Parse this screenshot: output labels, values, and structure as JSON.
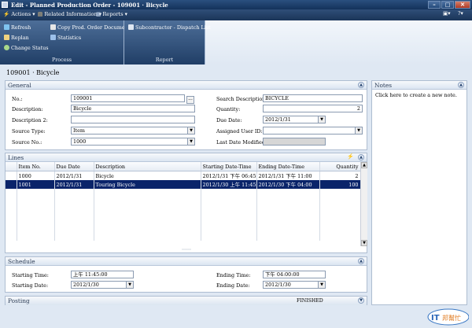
{
  "window": {
    "title": "Edit - Planned Production Order - 109001 · Bicycle",
    "controls": [
      "–",
      "□",
      "✕"
    ]
  },
  "menubar": {
    "items": [
      "Actions ▾",
      "Related Information ▾",
      "Reports ▾"
    ],
    "right_icons": [
      "view-icon",
      "help-icon"
    ]
  },
  "ribbon": {
    "process": {
      "label": "Process",
      "buttons": [
        "Refresh",
        "Replan",
        "Change Status",
        "Copy Prod. Order Document",
        "Statistics"
      ]
    },
    "report": {
      "label": "Report",
      "buttons": [
        "Subcontractor - Dispatch List"
      ]
    }
  },
  "page_heading": "109001 · Bicycle",
  "general": {
    "title": "General",
    "fields": {
      "no_label": "No.:",
      "no_value": "109001",
      "assist": "...",
      "description_label": "Description:",
      "description_value": "Bicycle",
      "description2_label": "Description 2:",
      "description2_value": "",
      "source_type_label": "Source Type:",
      "source_type_value": "Item",
      "source_no_label": "Source No.:",
      "source_no_value": "1000",
      "search_desc_label": "Search Description:",
      "search_desc_value": "BICYCLE",
      "quantity_label": "Quantity:",
      "quantity_value": "2",
      "due_date_label": "Due Date:",
      "due_date_value": "2012/1/31",
      "assigned_user_label": "Assigned User ID:",
      "assigned_user_value": "",
      "last_modified_label": "Last Date Modified:",
      "last_modified_value": ""
    }
  },
  "notes": {
    "title": "Notes",
    "link": "Click here to create a new note."
  },
  "lines": {
    "title": "Lines",
    "columns": [
      "Item No.",
      "Due Date",
      "Description",
      "Starting Date-Time",
      "Ending Date-Time",
      "Quantity"
    ],
    "rows": [
      [
        "1000",
        "2012/1/31",
        "Bicycle",
        "2012/1/31 下午 06:45",
        "2012/1/31 下午 11:00",
        "2"
      ],
      [
        "1001",
        "2012/1/31",
        "Touring Bicycle",
        "2012/1/30 上午 11:45",
        "2012/1/30 下午 04:00",
        "100"
      ]
    ]
  },
  "schedule": {
    "title": "Schedule",
    "starting_time_label": "Starting Time:",
    "starting_time_value": "上午 11:45:00",
    "starting_date_label": "Starting Date:",
    "starting_date_value": "2012/1/30",
    "ending_time_label": "Ending Time:",
    "ending_time_value": "下午 04:00:00",
    "ending_date_label": "Ending Date:",
    "ending_date_value": "2012/1/30"
  },
  "posting": {
    "title": "Posting",
    "status": "FINISHED"
  },
  "watermark": {
    "text": "IT邦幫忙"
  },
  "colors": {
    "titlebar": "#1d3b63",
    "ribbon": "#34557f",
    "selection": "#0a246a",
    "panel_border": "#aebdd1"
  }
}
